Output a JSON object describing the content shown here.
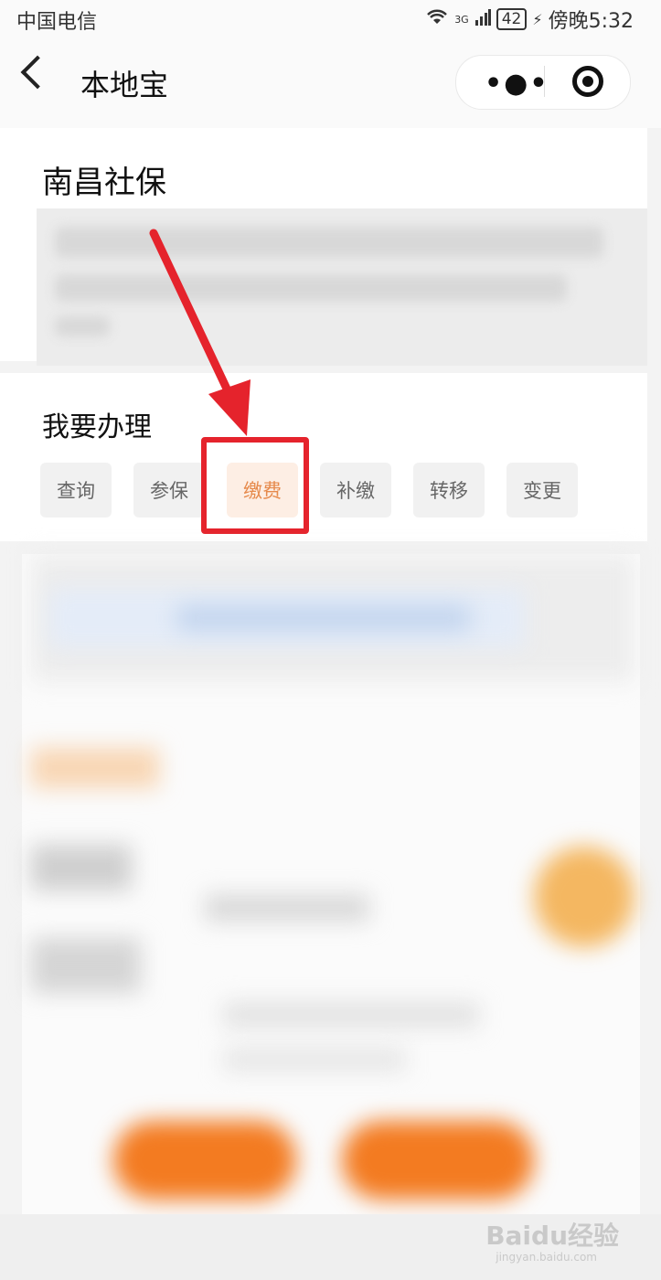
{
  "status_bar": {
    "carrier": "中国电信",
    "network": "3G",
    "battery": "42",
    "time": "傍晚5:32"
  },
  "nav": {
    "title": "本地宝",
    "icons": [
      "back-icon",
      "more-icon",
      "target-icon"
    ]
  },
  "page": {
    "title": "南昌社保"
  },
  "section": {
    "title": "我要办理",
    "actions": [
      {
        "label": "查询"
      },
      {
        "label": "参保"
      },
      {
        "label": "缴费"
      },
      {
        "label": "补缴"
      },
      {
        "label": "转移"
      },
      {
        "label": "变更"
      }
    ],
    "highlighted_action": "缴费"
  },
  "annotation": {
    "arrow_color": "#e5232c",
    "box_color": "#e5232c"
  },
  "watermark": {
    "text": "Baidu经验",
    "sub": "jingyan.baidu.com"
  },
  "colors": {
    "accent_orange": "#f37b21",
    "active_chip_bg": "#fdeee4",
    "active_chip_text": "#e68a4c"
  }
}
